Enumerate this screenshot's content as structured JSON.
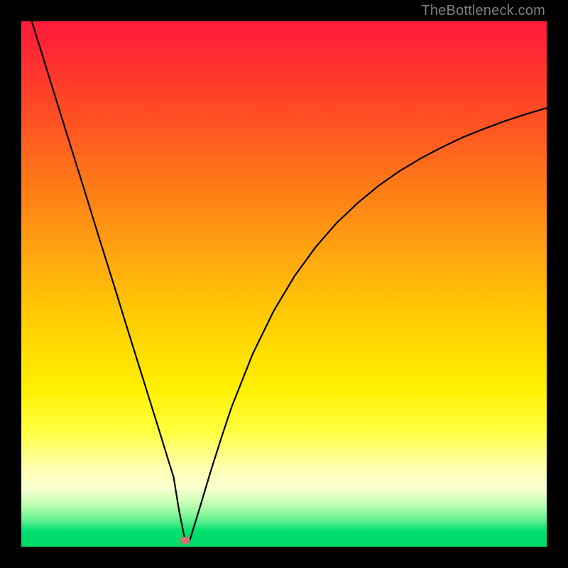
{
  "watermark": "TheBottleneck.com",
  "chart_data": {
    "type": "line",
    "title": "",
    "xlabel": "",
    "ylabel": "",
    "xlim": [
      0,
      100
    ],
    "ylim": [
      0,
      100
    ],
    "series": [
      {
        "name": "bottleneck-curve",
        "x": [
          2,
          4,
          6,
          8,
          10,
          12,
          14,
          16,
          18,
          20,
          22,
          24,
          26,
          28,
          29,
          30,
          31,
          32,
          34,
          36,
          38,
          40,
          44,
          48,
          52,
          56,
          60,
          64,
          68,
          72,
          76,
          80,
          84,
          88,
          92,
          96,
          100
        ],
        "y": [
          100,
          93.6,
          87.1,
          80.7,
          74.3,
          67.9,
          61.4,
          55.0,
          48.6,
          42.1,
          35.7,
          29.3,
          22.9,
          16.4,
          13.2,
          7.0,
          2.0,
          1.0,
          7.5,
          14.2,
          20.5,
          26.5,
          36.6,
          44.8,
          51.5,
          57.0,
          61.6,
          65.4,
          68.7,
          71.5,
          73.9,
          76.0,
          77.9,
          79.5,
          81.0,
          82.3,
          83.5
        ]
      }
    ],
    "marker": {
      "x": 31.2,
      "y": 1.2,
      "color": "#c8776a"
    },
    "background_gradient": {
      "stops": [
        {
          "pos": 0.0,
          "color": "#ff1a3a"
        },
        {
          "pos": 0.2,
          "color": "#ff5522"
        },
        {
          "pos": 0.45,
          "color": "#ffa810"
        },
        {
          "pos": 0.7,
          "color": "#fff000"
        },
        {
          "pos": 0.89,
          "color": "#f8ffd0"
        },
        {
          "pos": 1.0,
          "color": "#00d968"
        }
      ]
    }
  }
}
